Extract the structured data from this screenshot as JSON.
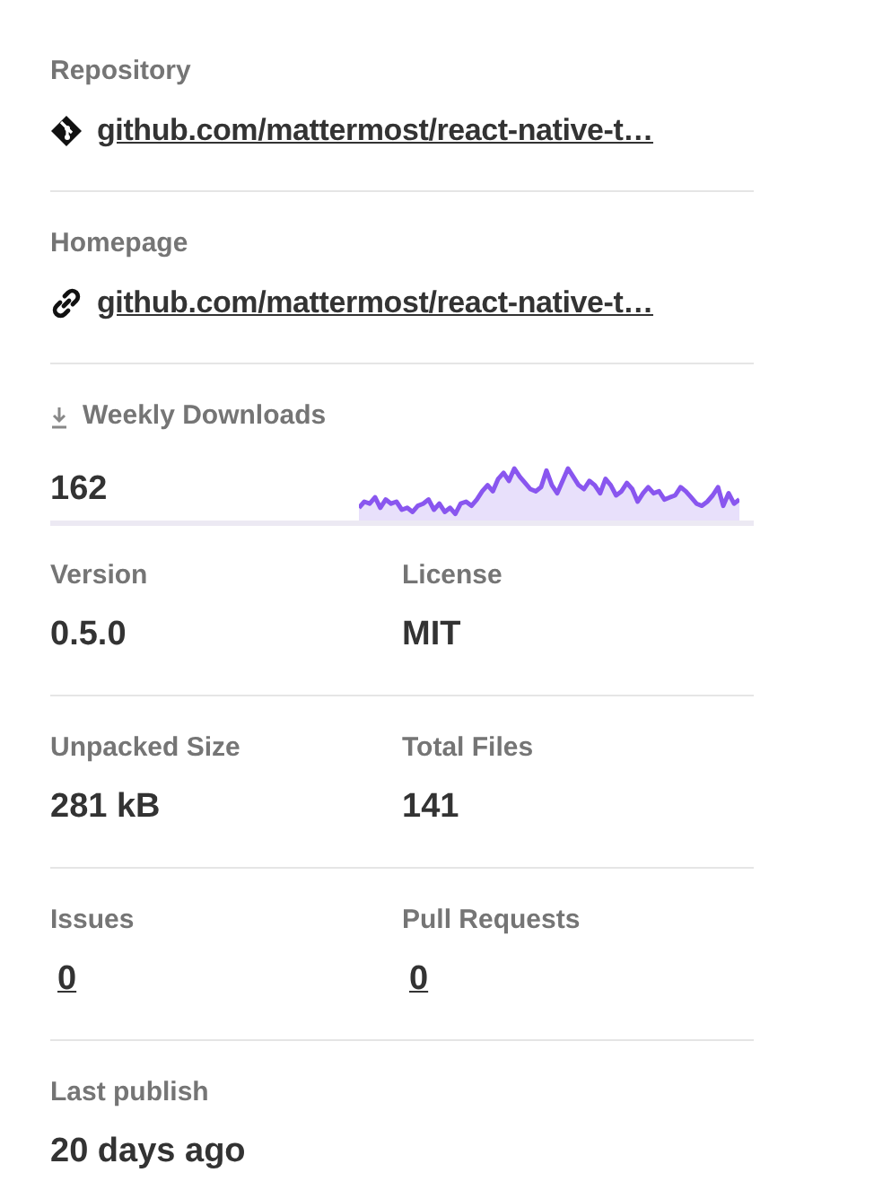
{
  "repository": {
    "label": "Repository",
    "link": "github.com/mattermost/react-native-t…"
  },
  "homepage": {
    "label": "Homepage",
    "link": "github.com/mattermost/react-native-t…"
  },
  "weekly_downloads": {
    "label": "Weekly Downloads",
    "count": "162"
  },
  "stats": [
    {
      "label": "Version",
      "value": "0.5.0",
      "kind": "text"
    },
    {
      "label": "License",
      "value": "MIT",
      "kind": "text"
    },
    {
      "label": "Unpacked Size",
      "value": "281 kB",
      "kind": "text"
    },
    {
      "label": "Total Files",
      "value": "141",
      "kind": "text"
    },
    {
      "label": "Issues",
      "value": "0",
      "kind": "link"
    },
    {
      "label": "Pull Requests",
      "value": "0",
      "kind": "link"
    }
  ],
  "last_publish": {
    "label": "Last publish",
    "value": "20 days ago"
  }
}
